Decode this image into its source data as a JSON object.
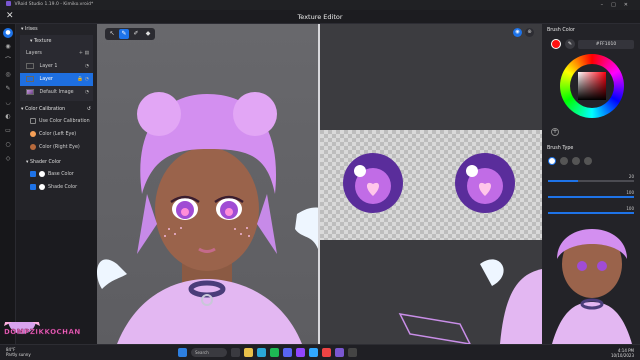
{
  "os_titlebar": {
    "title": "VRoid Studio 1.19.0 - Kimiko.vroid*"
  },
  "editor": {
    "title": "Texture Editor"
  },
  "left_panel": {
    "irises_label": "Irises",
    "texture_label": "Texture",
    "layers_label": "Layers",
    "layers": [
      {
        "name": "Layer 1",
        "selected": false
      },
      {
        "name": "Layer",
        "selected": true
      },
      {
        "name": "Default Image",
        "selected": false
      }
    ],
    "color_calibration_label": "Color Calibration",
    "use_color_calibration_label": "Use Color Calibration",
    "color_left_eye": "Color (Left Eye)",
    "color_right_eye": "Color (Right Eye)",
    "left_eye_color": "#f5a057",
    "right_eye_color": "#b86a3c",
    "shader_color_label": "Shader Color",
    "base_color_label": "Base Color",
    "shade_color_label": "Shade Color"
  },
  "right_panel": {
    "brush_color_label": "Brush Color",
    "hex_value": "#FF1010",
    "brush_color": "#ff1010",
    "brush_type_label": "Brush Type",
    "slider_values": [
      "20",
      "100",
      "100"
    ]
  },
  "overlay": {
    "streamer_banner": "DOMPZIKKOCHAN"
  },
  "taskbar": {
    "weather_temp": "84°F",
    "weather_desc": "Partly sunny",
    "search_placeholder": "Search",
    "time": "4:14 PM",
    "date": "10/10/2023"
  },
  "colors": {
    "accent": "#1e73e8",
    "panel_bg": "#232328",
    "viewport_bg": "#626266"
  }
}
